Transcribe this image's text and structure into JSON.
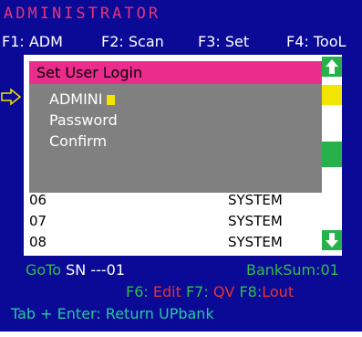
{
  "title": "ADMINISTRATOR",
  "function_keys": [
    {
      "label": "F1: ADM"
    },
    {
      "label": "F2: Scan"
    },
    {
      "label": "F3: Set"
    },
    {
      "label": "F4: TooL"
    }
  ],
  "dialog": {
    "title": "Set User Login",
    "fields": {
      "username_value": "ADMINI",
      "password_label": "Password",
      "confirm_label": "Confirm"
    }
  },
  "list_rows": [
    {
      "number": "06",
      "name": "SYSTEM"
    },
    {
      "number": "07",
      "name": "SYSTEM"
    },
    {
      "number": "08",
      "name": "SYSTEM"
    }
  ],
  "status": {
    "goto_label": "GoTo",
    "sn_label": "SN ---01",
    "banksum_label": "BankSum:01"
  },
  "shortcuts": {
    "f6_key": "F6:",
    "f6_action": "Edit",
    "f7_key": "F7:",
    "f7_action": "QV",
    "f8_key": "F8:",
    "f8_action": "Lout"
  },
  "footer_hint": "Tab + Enter: Return UPbank",
  "icons": {
    "scroll_up": "arrow-up-icon",
    "scroll_down": "arrow-down-icon",
    "pointer": "arrow-right-outline-icon"
  },
  "colors": {
    "background": "#0a0a96",
    "title": "#e8327a",
    "dialog_title_bar": "#ea2d8c",
    "dialog_body": "#808080",
    "accent_green": "#27b14a",
    "cursor_yellow": "#f2e600",
    "action_red": "#e8322f"
  }
}
